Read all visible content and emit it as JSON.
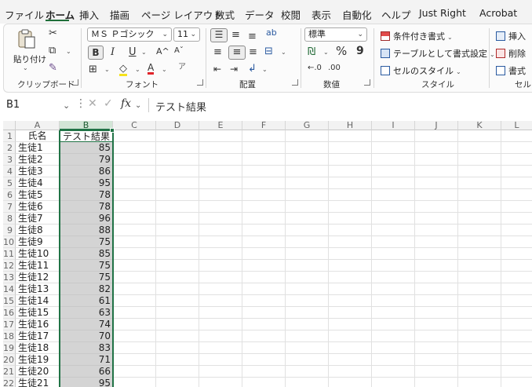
{
  "menu": {
    "tabs": [
      {
        "label": "ファイル"
      },
      {
        "label": "ホーム"
      },
      {
        "label": "挿入"
      },
      {
        "label": "描画"
      },
      {
        "label": "ページ レイアウト"
      },
      {
        "label": "数式"
      },
      {
        "label": "データ"
      },
      {
        "label": "校閲"
      },
      {
        "label": "表示"
      },
      {
        "label": "自動化"
      },
      {
        "label": "ヘルプ"
      },
      {
        "label": "Just Right"
      },
      {
        "label": "Acrobat"
      }
    ],
    "active_index": 1
  },
  "ribbon": {
    "clipboard": {
      "label": "クリップボード",
      "paste_label": "貼り付け"
    },
    "font": {
      "label": "フォント",
      "font_name": "ＭＳ Ｐゴシック",
      "font_size": "11",
      "bold": "B",
      "italic": "I",
      "underline": "U"
    },
    "alignment": {
      "label": "配置"
    },
    "number": {
      "label": "数値",
      "format": "標準",
      "percent": "%",
      "comma": "9"
    },
    "styles": {
      "label": "スタイル",
      "conditional": "条件付き書式",
      "table": "テーブルとして書式設定",
      "cell_style": "セルのスタイル"
    },
    "cells": {
      "label": "セル",
      "insert": "挿入",
      "delete": "削除",
      "format": "書式"
    }
  },
  "formula_bar": {
    "name_box": "B1",
    "fx": "fx",
    "content": "テスト結果"
  },
  "grid": {
    "columns": [
      "A",
      "B",
      "C",
      "D",
      "E",
      "F",
      "G",
      "H",
      "I",
      "J",
      "K",
      "L"
    ],
    "selected_column": "B",
    "header_row": {
      "row": "1",
      "a": "氏名",
      "b": "テスト結果"
    },
    "rows": [
      {
        "row": "2",
        "name": "生徒1",
        "score": "85"
      },
      {
        "row": "3",
        "name": "生徒2",
        "score": "79"
      },
      {
        "row": "4",
        "name": "生徒3",
        "score": "86"
      },
      {
        "row": "5",
        "name": "生徒4",
        "score": "95"
      },
      {
        "row": "6",
        "name": "生徒5",
        "score": "78"
      },
      {
        "row": "7",
        "name": "生徒6",
        "score": "78"
      },
      {
        "row": "8",
        "name": "生徒7",
        "score": "96"
      },
      {
        "row": "9",
        "name": "生徒8",
        "score": "88"
      },
      {
        "row": "10",
        "name": "生徒9",
        "score": "75"
      },
      {
        "row": "11",
        "name": "生徒10",
        "score": "85"
      },
      {
        "row": "12",
        "name": "生徒11",
        "score": "75"
      },
      {
        "row": "13",
        "name": "生徒12",
        "score": "75"
      },
      {
        "row": "14",
        "name": "生徒13",
        "score": "82"
      },
      {
        "row": "15",
        "name": "生徒14",
        "score": "61"
      },
      {
        "row": "16",
        "name": "生徒15",
        "score": "63"
      },
      {
        "row": "17",
        "name": "生徒16",
        "score": "74"
      },
      {
        "row": "18",
        "name": "生徒17",
        "score": "70"
      },
      {
        "row": "19",
        "name": "生徒18",
        "score": "83"
      },
      {
        "row": "20",
        "name": "生徒19",
        "score": "71"
      },
      {
        "row": "21",
        "name": "生徒20",
        "score": "66"
      },
      {
        "row": "22",
        "name": "生徒21",
        "score": "95"
      }
    ]
  },
  "colors": {
    "accent": "#217346",
    "selection": "#d4d4d4"
  }
}
